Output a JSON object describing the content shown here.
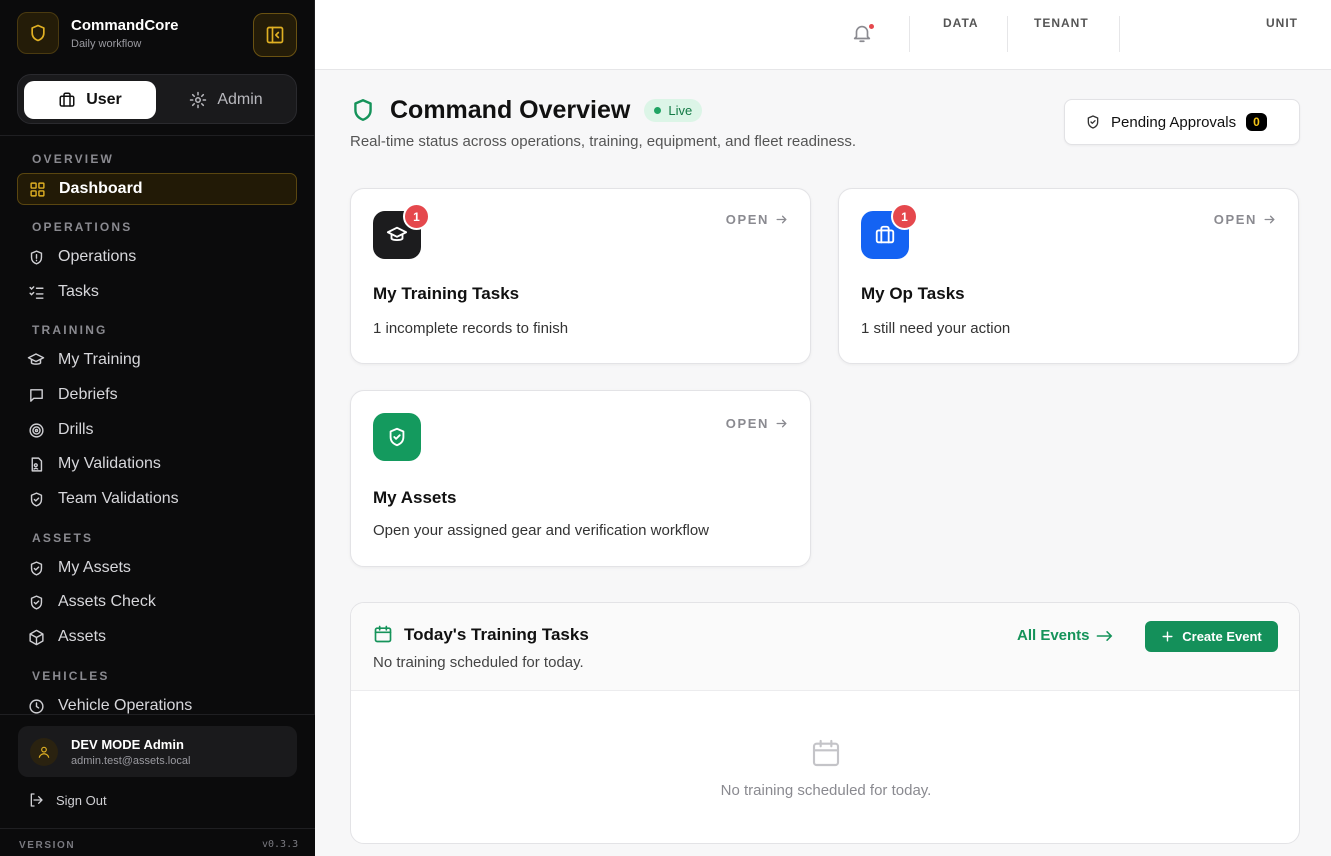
{
  "brand": {
    "name": "CommandCore",
    "subtitle": "Daily workflow"
  },
  "mode_switch": {
    "user_label": "User",
    "admin_label": "Admin",
    "active": "User"
  },
  "sidebar": {
    "sections": [
      {
        "title": "OVERVIEW",
        "items": [
          {
            "label": "Dashboard",
            "icon": "grid-icon",
            "active": true
          }
        ]
      },
      {
        "title": "OPERATIONS",
        "items": [
          {
            "label": "Operations",
            "icon": "shield-alert-icon"
          },
          {
            "label": "Tasks",
            "icon": "list-check-icon"
          }
        ]
      },
      {
        "title": "TRAINING",
        "items": [
          {
            "label": "My Training",
            "icon": "graduation-cap-icon"
          },
          {
            "label": "Debriefs",
            "icon": "message-square-icon"
          },
          {
            "label": "Drills",
            "icon": "target-icon"
          },
          {
            "label": "My Validations",
            "icon": "file-user-icon"
          },
          {
            "label": "Team Validations",
            "icon": "shield-check-icon"
          }
        ]
      },
      {
        "title": "ASSETS",
        "items": [
          {
            "label": "My Assets",
            "icon": "shield-check-icon"
          },
          {
            "label": "Assets Check",
            "icon": "shield-check-icon"
          },
          {
            "label": "Assets",
            "icon": "box-icon"
          }
        ]
      },
      {
        "title": "VEHICLES",
        "items": [
          {
            "label": "Vehicle Operations",
            "icon": "clock-icon"
          }
        ]
      }
    ]
  },
  "user": {
    "name": "DEV MODE Admin",
    "email": "admin.test@assets.local"
  },
  "signout_label": "Sign Out",
  "version": {
    "label": "VERSION",
    "number": "v0.3.3"
  },
  "topbar": {
    "labels": [
      "DATA",
      "TENANT",
      "UNIT"
    ]
  },
  "header": {
    "title": "Command Overview",
    "live_label": "Live",
    "subtitle": "Real-time status across operations, training, equipment, and fleet readiness.",
    "pending_label": "Pending Approvals",
    "pending_count": "0"
  },
  "cards": [
    {
      "title": "My Training Tasks",
      "desc": "1 incomplete records to finish",
      "open": "OPEN",
      "badge": "1",
      "icon": "graduation-cap-icon",
      "color": "#1c1c1e"
    },
    {
      "title": "My Op Tasks",
      "desc": "1 still need your action",
      "open": "OPEN",
      "badge": "1",
      "icon": "briefcase-icon",
      "color": "#1463f3"
    },
    {
      "title": "My Assets",
      "desc": "Open your assigned gear and verification workflow",
      "open": "OPEN",
      "badge": null,
      "icon": "shield-check-icon",
      "color": "#149a5e"
    }
  ],
  "today": {
    "title": "Today's Training Tasks",
    "subtitle": "No training scheduled for today.",
    "all_events": "All Events",
    "create_label": "Create Event",
    "empty_text": "No training scheduled for today."
  }
}
